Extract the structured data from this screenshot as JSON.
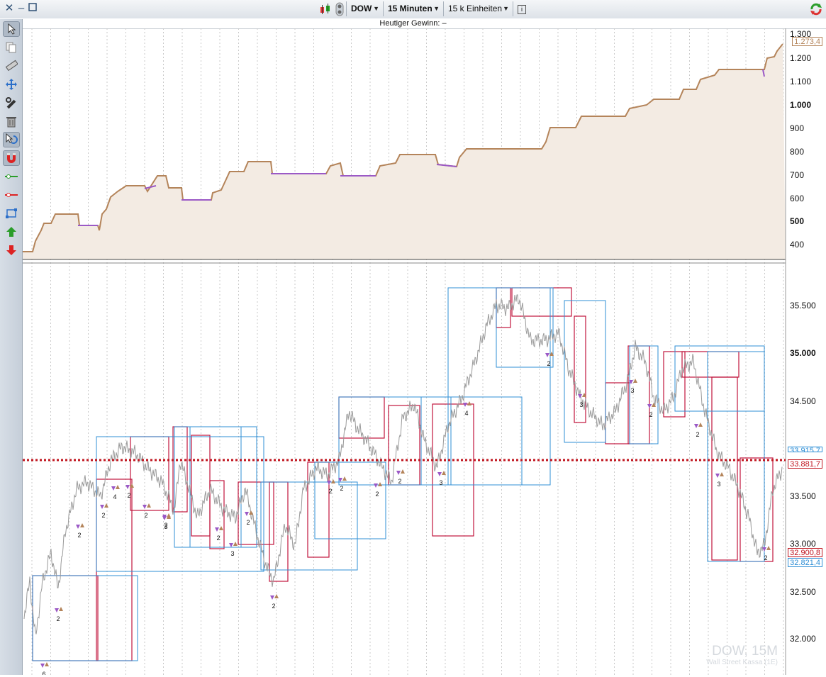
{
  "toolbar_top": {
    "symbol": "DOW",
    "interval": "15 Minuten",
    "units": "15 k Einheiten",
    "info_icon": "i"
  },
  "subtitle": "Heutiger Gewinn: –",
  "equity_panel": {
    "y_ticks": [
      "1.300",
      "1.200",
      "1.100",
      "1.000",
      "900",
      "800",
      "700",
      "600",
      "500",
      "400"
    ],
    "bold_ticks": [
      "1.000",
      "500"
    ],
    "current_value": "1.273,4",
    "profit_color": "#b4845a",
    "loss_color": "#9b59c6",
    "fill_color": "#f3ebe3"
  },
  "price_panel": {
    "y_ticks": [
      "35.500",
      "35.000",
      "34.500",
      "33.500",
      "33.000",
      "32.500",
      "32.000"
    ],
    "bold_ticks": [
      "35.000"
    ],
    "last_price": "33.881,7",
    "hidden_price": "33.915,7",
    "red_level": "32.900,8",
    "blue_level": "32.821,4",
    "trade_counts": [
      "2",
      "2",
      "2",
      "4",
      "2",
      "2",
      "2",
      "3",
      "2",
      "3",
      "2",
      "2",
      "2",
      "2",
      "2",
      "2",
      "3",
      "4",
      "2",
      "3",
      "3",
      "2",
      "2",
      "3",
      "2",
      "6"
    ],
    "watermark_symbol": "DOW, 15M",
    "watermark_source": "Wall Street Kassa (1E)",
    "line_red": "#c0143c",
    "line_blue": "#2f8fd6",
    "price_color": "#9a9a9a"
  },
  "tools": [
    {
      "name": "pointer-tool-icon",
      "active": true
    },
    {
      "name": "copy-icon",
      "active": false
    },
    {
      "name": "ruler-icon",
      "active": false
    },
    {
      "name": "move-icon",
      "active": false
    },
    {
      "name": "settings-tools-icon",
      "active": false
    },
    {
      "name": "trash-icon",
      "active": false
    },
    {
      "name": "undo-pointer-icon",
      "active": true
    },
    {
      "name": "magnet-icon",
      "active": true
    },
    {
      "name": "green-line-icon",
      "active": false
    },
    {
      "name": "red-line-icon",
      "active": false
    },
    {
      "name": "rectangle-tool-icon",
      "active": false
    },
    {
      "name": "buy-arrow-icon",
      "active": false
    },
    {
      "name": "sell-arrow-icon",
      "active": false
    }
  ]
}
